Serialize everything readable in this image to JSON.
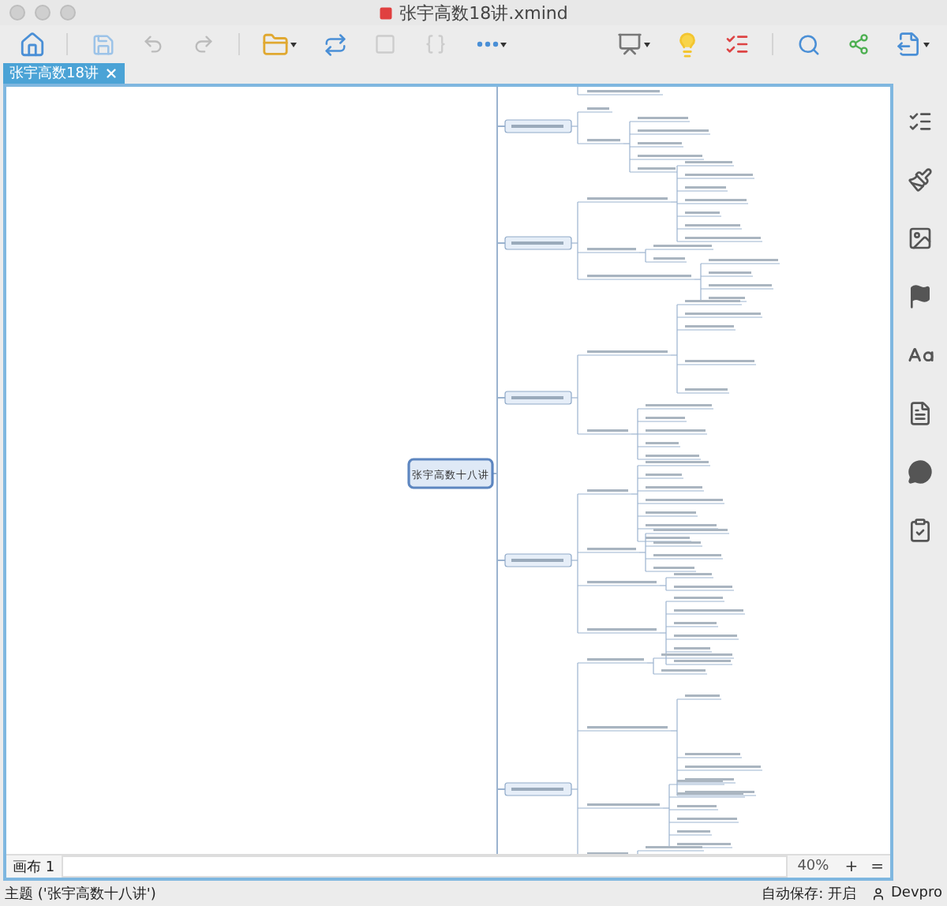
{
  "window": {
    "title": "张宇高数18讲.xmind"
  },
  "tabs": [
    {
      "label": "张宇高数18讲",
      "selected": true
    }
  ],
  "mindmap": {
    "central_topic": "张宇高数十八讲"
  },
  "sheet_bar": {
    "sheets": [
      {
        "label": "画布 1",
        "selected": true
      }
    ],
    "zoom": "40%",
    "zoom_in": "+",
    "fit": "="
  },
  "status_bar": {
    "selection": "主题 ('张宇高数十八讲')",
    "autosave": "自动保存: 开启",
    "user": "Devpro"
  }
}
